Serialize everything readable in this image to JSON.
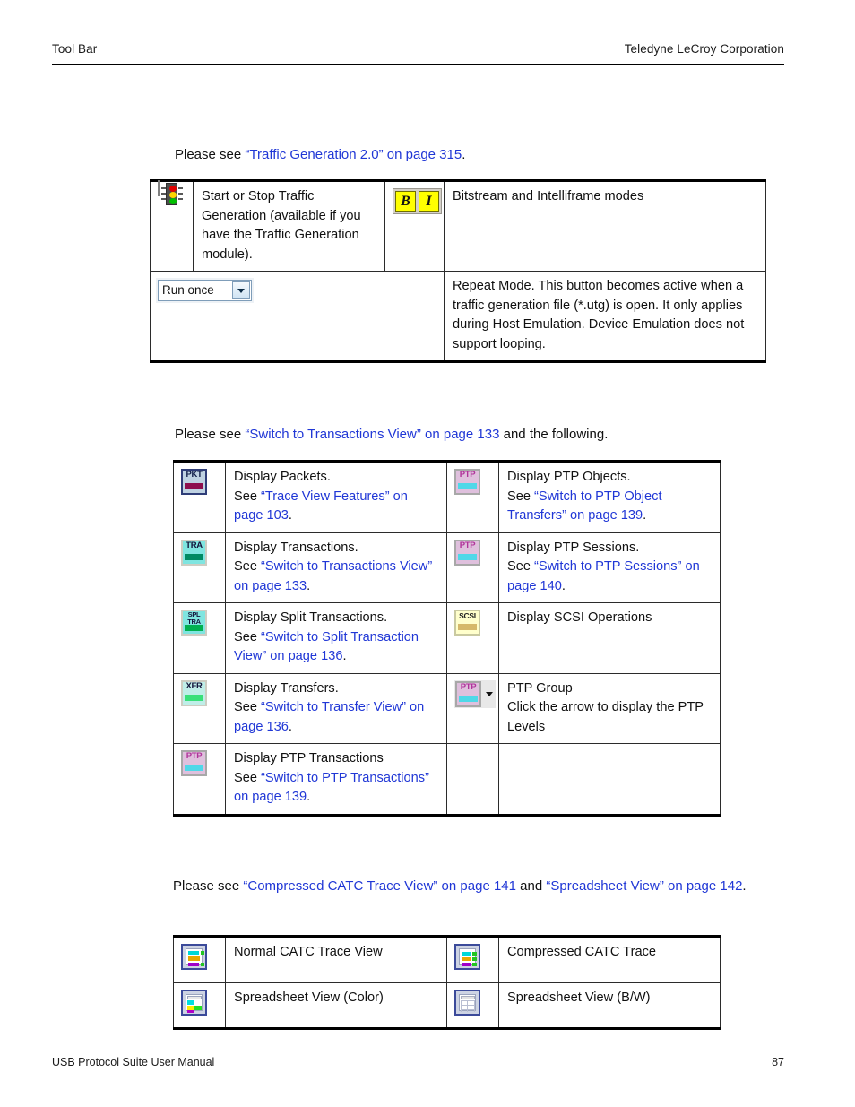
{
  "page": {
    "header_left": "Tool Bar",
    "header_right": "Teledyne LeCroy Corporation",
    "footer_left": "USB Protocol Suite User Manual",
    "footer_right": "87"
  },
  "colors": {
    "link": "#2037d6",
    "rule": "#000000"
  },
  "paragraphs": {
    "p1": {
      "prefix": "Please see ",
      "link": "“Traffic Generation 2.0” on page 315",
      "suffix": "."
    },
    "p2": {
      "prefix": "Please see ",
      "link": "“Switch to Transactions View” on page 133",
      "suffix": " and the following."
    },
    "p3": {
      "prefix": "Please see ",
      "link1": "“Compressed CATC Trace View” on page 141",
      "mid": " and ",
      "link2": "“Spreadsheet View” on page 142",
      "suffix": "."
    }
  },
  "table1": {
    "rows": [
      {
        "left_icon": "traffic-light-icon",
        "left_text": "Start or Stop Traffic Generation (available if you have the Traffic Generation module).",
        "right_icon": "bitstream-intelliframe-icon",
        "right_icon_labels": [
          "B",
          "I"
        ],
        "right_text": "Bitstream and Intelliframe modes"
      },
      {
        "left_icon": "run-once-combobox",
        "combo_value": "Run once",
        "left_text": "",
        "right_icon": "",
        "right_text": "Repeat Mode. This button becomes active when a traffic generation file (*.utg) is open. It only applies during Host Emulation. Device Emulation does not support looping."
      }
    ]
  },
  "table2": {
    "rows": [
      {
        "left": {
          "icon": "display-packets-icon",
          "icon_label": "PKT",
          "line1": "Display Packets.",
          "see": "See ",
          "link": "“Trace View Features” on page 103",
          "end": "."
        },
        "right": {
          "icon": "display-ptp-objects-icon",
          "icon_label": "PTP",
          "line1": "Display PTP Objects.",
          "see": "See ",
          "link": "“Switch to PTP Object Transfers” on page 139",
          "end": "."
        }
      },
      {
        "left": {
          "icon": "display-transactions-icon",
          "icon_label": "TRA",
          "line1": "Display Transactions.",
          "see": "See ",
          "link": "“Switch to Transactions View” on page 133",
          "end": "."
        },
        "right": {
          "icon": "display-ptp-sessions-icon",
          "icon_label": "PTP",
          "line1": "Display PTP Sessions.",
          "see": "See ",
          "link": "“Switch to PTP Sessions” on page 140",
          "end": "."
        }
      },
      {
        "left": {
          "icon": "display-split-transactions-icon",
          "icon_label": "SPL\nTRA",
          "line1": "Display Split Transactions.",
          "see": "See ",
          "link": "“Switch to Split Transaction View” on page 136",
          "end": "."
        },
        "right": {
          "icon": "display-scsi-operations-icon",
          "icon_label": "SCSI",
          "line1": "Display SCSI Operations",
          "see": "",
          "link": "",
          "end": ""
        }
      },
      {
        "left": {
          "icon": "display-transfers-icon",
          "icon_label": "XFR",
          "line1": "Display Transfers.",
          "see": "See ",
          "link": "“Switch to Transfer View” on page 136",
          "end": "."
        },
        "right": {
          "icon": "ptp-group-icon",
          "icon_label": "PTP",
          "line1": "PTP Group",
          "line2": "Click the arrow to display the PTP Levels",
          "see": "",
          "link": "",
          "end": ""
        }
      },
      {
        "left": {
          "icon": "display-ptp-transactions-icon",
          "icon_label": "PTP",
          "line1": "Display PTP Transactions",
          "see": "See ",
          "link": "“Switch to PTP Transactions” on page 139",
          "end": "."
        },
        "right": {
          "icon": "",
          "icon_label": "",
          "line1": "",
          "see": "",
          "link": "",
          "end": ""
        }
      }
    ]
  },
  "table3": {
    "rows": [
      {
        "left_icon": "normal-catc-trace-view-icon",
        "left_text": "Normal CATC Trace View",
        "right_icon": "compressed-catc-trace-icon",
        "right_text": "Compressed CATC Trace"
      },
      {
        "left_icon": "spreadsheet-view-color-icon",
        "left_text": "Spreadsheet View (Color)",
        "right_icon": "spreadsheet-view-bw-icon",
        "right_text": "Spreadsheet View (B/W)"
      }
    ]
  }
}
